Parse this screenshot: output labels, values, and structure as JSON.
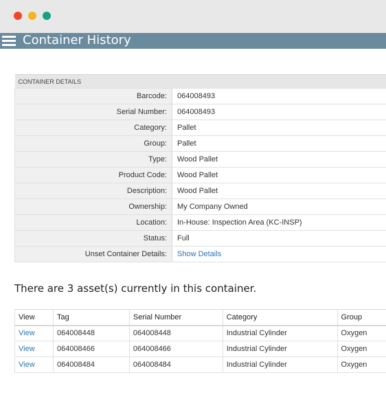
{
  "window": {
    "controls": [
      "close",
      "minimize",
      "maximize"
    ]
  },
  "header": {
    "title": "Container History",
    "menu_icon": "hamburger-menu-icon"
  },
  "details": {
    "section_title": "CONTAINER DETAILS",
    "rows": [
      {
        "label": "Barcode:",
        "value": "064008493"
      },
      {
        "label": "Serial Number:",
        "value": "064008493"
      },
      {
        "label": "Category:",
        "value": "Pallet"
      },
      {
        "label": "Group:",
        "value": "Pallet"
      },
      {
        "label": "Type:",
        "value": "Wood Pallet"
      },
      {
        "label": "Product Code:",
        "value": "Wood Pallet"
      },
      {
        "label": "Description:",
        "value": "Wood Pallet"
      },
      {
        "label": "Ownership:",
        "value": "My Company Owned"
      },
      {
        "label": "Location:",
        "value": "In-House: Inspection Area (KC-INSP)"
      },
      {
        "label": "Status:",
        "value": "Full"
      },
      {
        "label": "Unset Container Details:",
        "value": "Show Details"
      }
    ]
  },
  "assets": {
    "heading": "There are 3 asset(s) currently in this container.",
    "columns": [
      "View",
      "Tag",
      "Serial Number",
      "Category",
      "Group"
    ],
    "rows": [
      {
        "view": "View",
        "tag": "064008448",
        "serial": "064008448",
        "category": "Industrial Cylinder",
        "group": "Oxygen"
      },
      {
        "view": "View",
        "tag": "064008466",
        "serial": "064008466",
        "category": "Industrial Cylinder",
        "group": "Oxygen"
      },
      {
        "view": "View",
        "tag": "064008484",
        "serial": "064008484",
        "category": "Industrial Cylinder",
        "group": "Oxygen"
      }
    ]
  },
  "colors": {
    "header_bg": "#6a8a9e",
    "link": "#2a74b8",
    "close": "#f0462b",
    "minimize": "#f5b520",
    "maximize": "#16a085"
  }
}
